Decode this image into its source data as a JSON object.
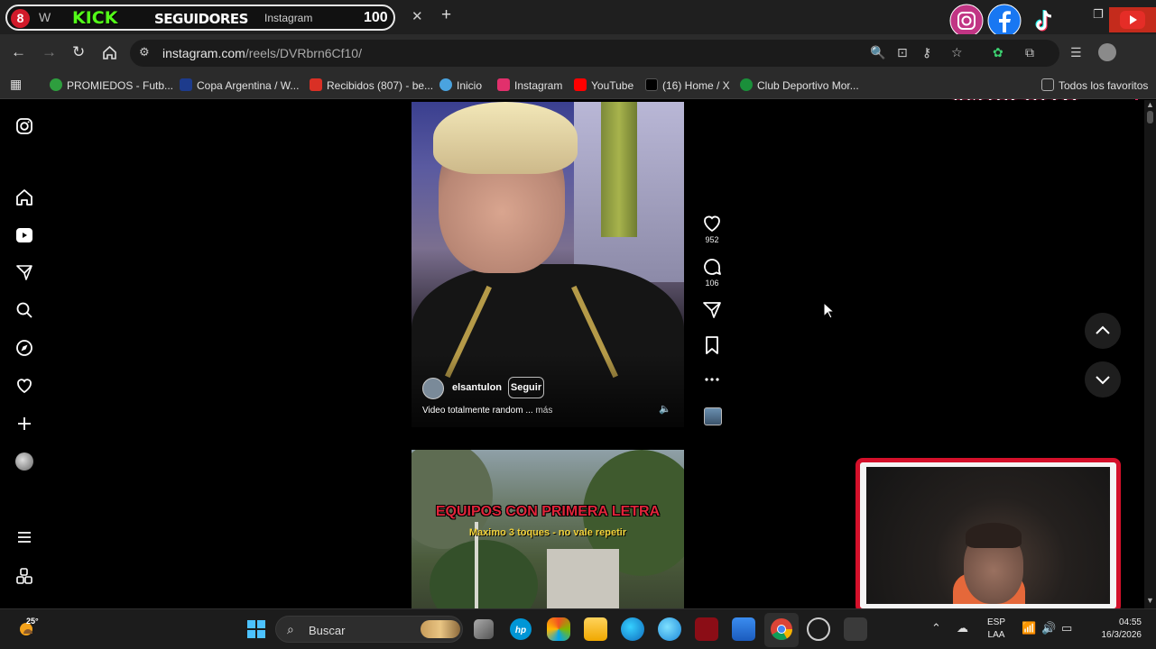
{
  "browser": {
    "tab": {
      "badge": "8",
      "whatsapp_glyph": "W",
      "kick_text": "KICK",
      "seguidores_text": "SEGUIDORES",
      "title": "Instagram",
      "counter": "100"
    },
    "close_tab_glyph": "✕",
    "new_tab_glyph": "+",
    "url_host": "instagram.com",
    "url_path": "/reels/DVRbrn6Cf10/",
    "bookmarks": [
      {
        "label": "PROMIEDOS - Futb...",
        "color": "#2e9e3e"
      },
      {
        "label": "Copa Argentina / W...",
        "color": "#1d3b8c"
      },
      {
        "label": "Recibidos (807) - be...",
        "color": "#d93025"
      },
      {
        "label": "Inicio",
        "color": "#4aa3df"
      },
      {
        "label": "Instagram",
        "color": "#e1306c"
      },
      {
        "label": "YouTube",
        "color": "#ff0000"
      },
      {
        "label": "(16) Home / X",
        "color": "#000000"
      },
      {
        "label": "Club Deportivo Mor...",
        "color": "#1a8f3a"
      }
    ],
    "all_bookmarks": "Todos los favoritos",
    "overlay_name": "@tluchi16"
  },
  "sidebar": {
    "items": [
      "instagram-logo",
      "home",
      "reels",
      "messages",
      "search",
      "explore",
      "notifications",
      "create",
      "profile",
      "more",
      "also-from-meta"
    ]
  },
  "reel1": {
    "username": "elsantulon",
    "follow_label": "Seguir",
    "caption": "Video totalmente random ...",
    "more_label": "más",
    "likes": "952",
    "comments": "106"
  },
  "reel2": {
    "title": "EQUIPOS CON PRIMERA LETRA",
    "subtitle": "Maximo 3 toques - no vale repetir"
  },
  "taskbar": {
    "temperature": "25°",
    "search_placeholder": "Buscar",
    "language_line1": "ESP",
    "language_line2": "LAA",
    "time": "04:55",
    "date": "16/3/2026"
  },
  "colors": {
    "accent_red": "#d4102a",
    "kick_green": "#53fc18",
    "instagram_pink": "#e1306c"
  }
}
